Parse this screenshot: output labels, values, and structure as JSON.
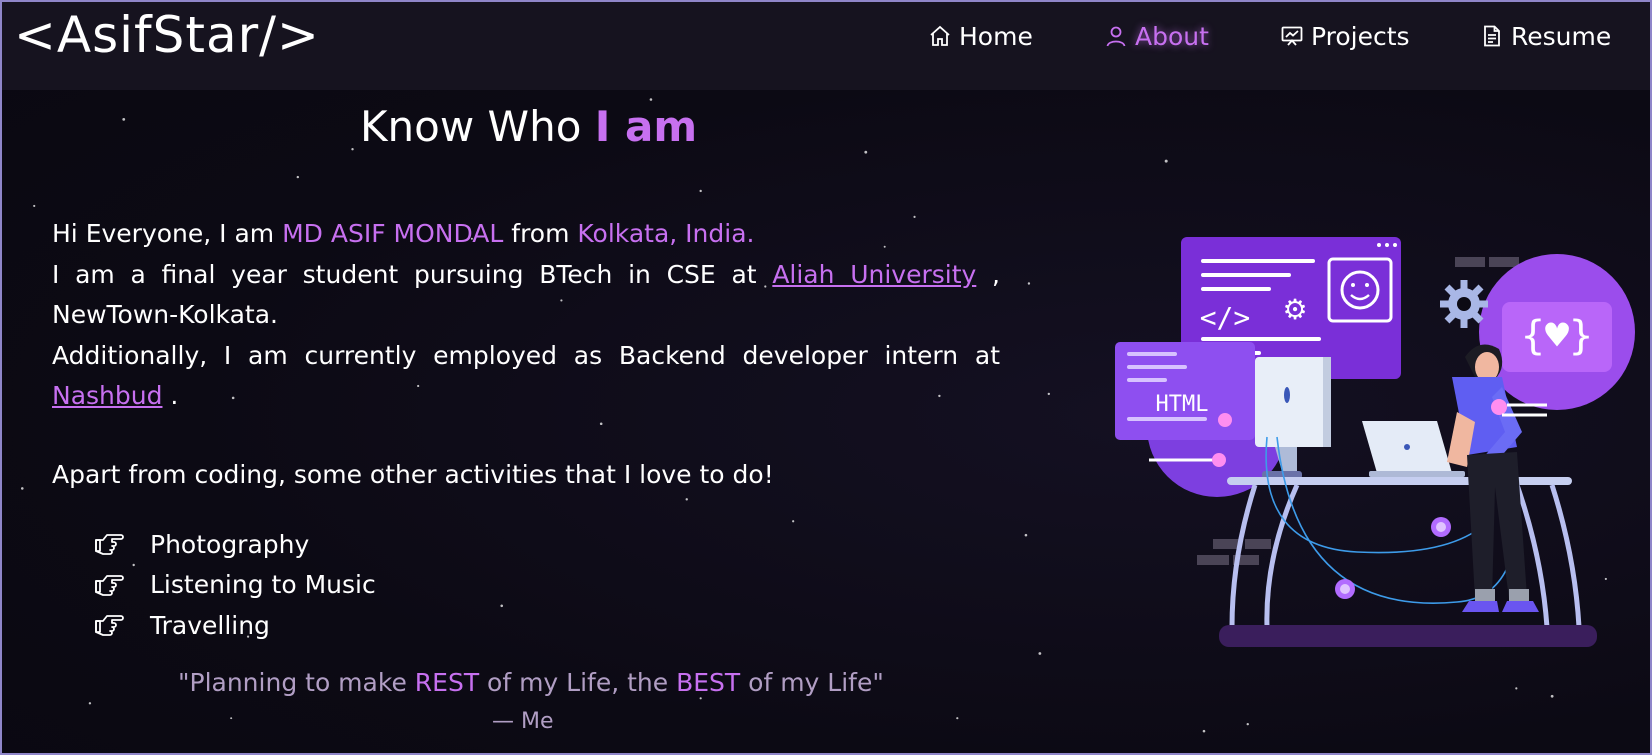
{
  "navbar": {
    "logo": "<AsifStar/>",
    "items": [
      {
        "label": "Home",
        "icon": "home-icon",
        "active": false
      },
      {
        "label": "About",
        "icon": "user-icon",
        "active": true
      },
      {
        "label": "Projects",
        "icon": "presentation-icon",
        "active": false
      },
      {
        "label": "Resume",
        "icon": "document-icon",
        "active": false
      }
    ]
  },
  "main": {
    "heading_prefix": "Know Who ",
    "heading_accent": "I am",
    "bio": {
      "line1_prefix": "Hi Everyone, I am ",
      "name": "MD ASIF MONDAL",
      "line1_mid": " from ",
      "location": "Kolkata, India.",
      "line2_prefix": "I am a final year student pursuing BTech in CSE at ",
      "university_link": "Aliah University",
      "line2_suffix": " , NewTown-Kolkata.",
      "line3_prefix": "Additionally, I am currently employed as Backend developer intern at ",
      "company_link": "Nashbud",
      "line3_suffix": " ."
    },
    "activities_intro": "Apart from coding, some other activities that I love to do!",
    "activities": [
      "Photography",
      "Listening to Music",
      "Travelling"
    ],
    "quote": {
      "open": "\"Planning to make ",
      "word1": "REST",
      "mid": " of my Life, the ",
      "word2": "BEST",
      "close": " of my Life\""
    },
    "attribution": "— Me",
    "illustration_text": "HTML"
  },
  "colors": {
    "accent": "#c770f0",
    "background": "#0c0a14",
    "navbar": "#16131f",
    "quote": "#b19ec4"
  }
}
